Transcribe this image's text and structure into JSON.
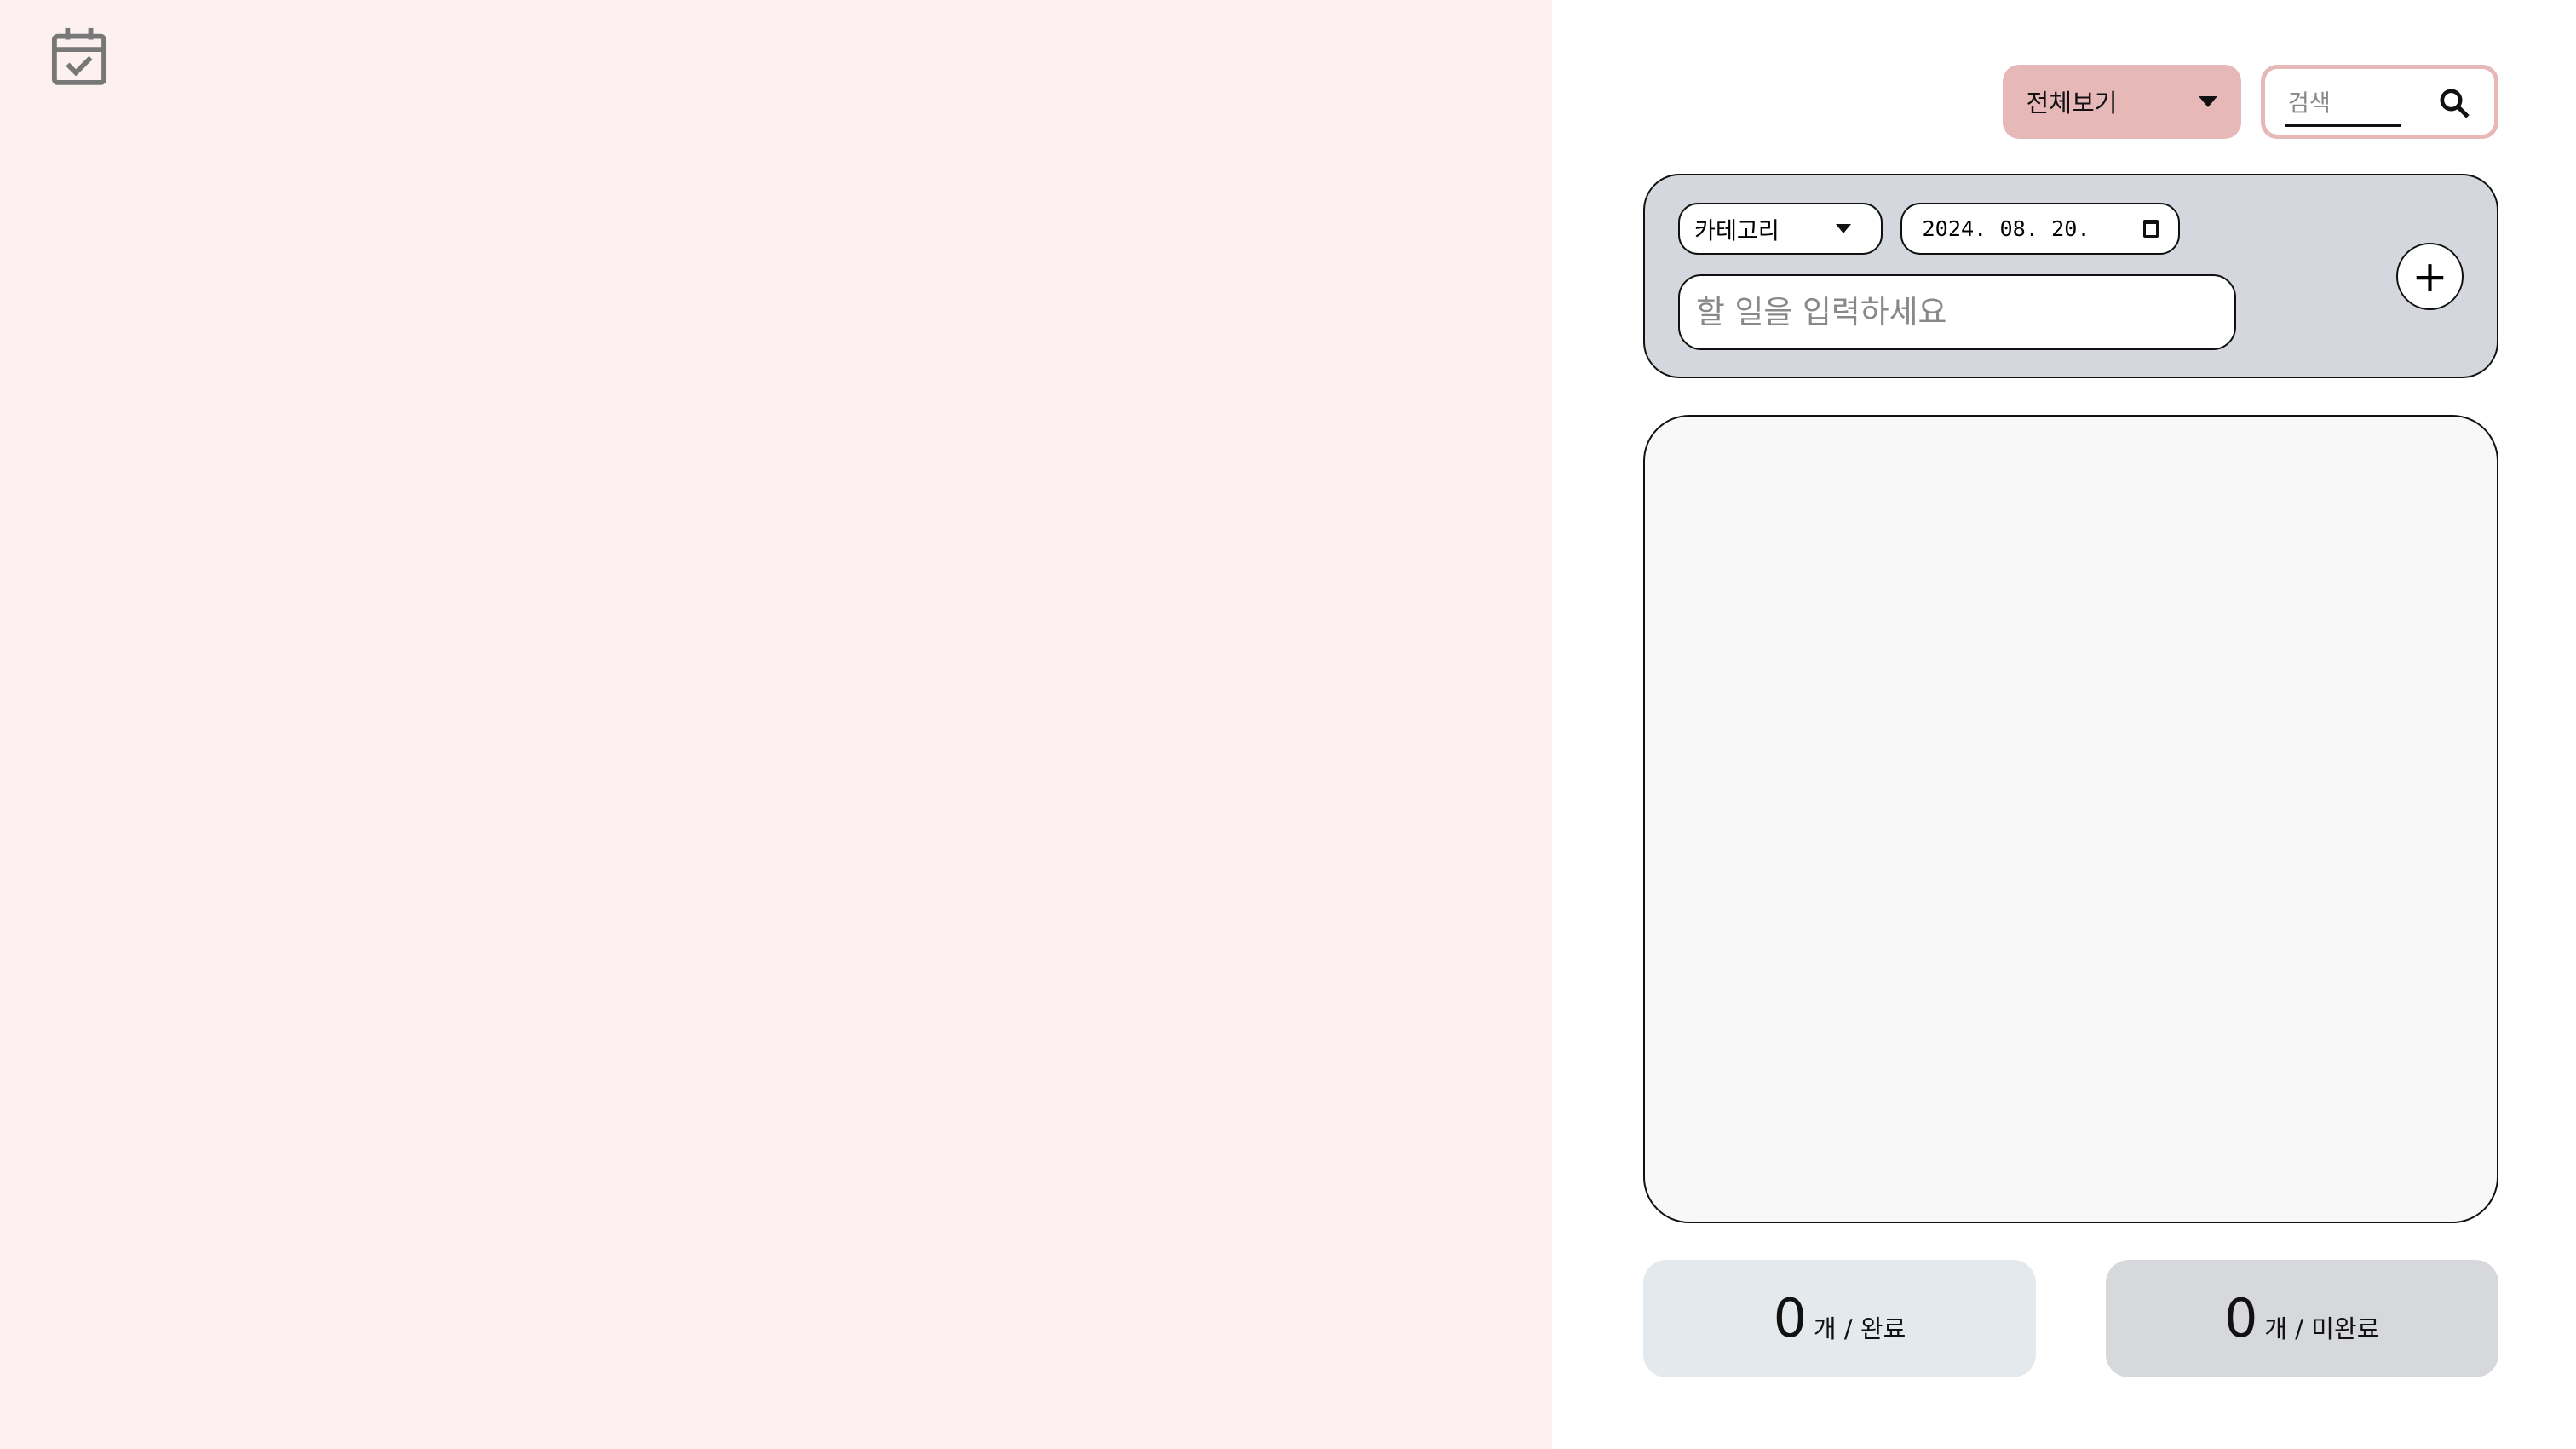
{
  "sidebar": {
    "icon": "calendar-check-icon",
    "background": "#fcf1f0"
  },
  "header": {
    "filter": {
      "selected": "전체보기",
      "icon": "caret-down-icon",
      "color": "#e6b8b8"
    },
    "search": {
      "placeholder": "검색",
      "value": "",
      "icon": "search-icon"
    }
  },
  "form": {
    "category": {
      "selected": "카테고리",
      "icon": "caret-down-icon"
    },
    "date": {
      "value": "2024. 08. 20.",
      "icon": "calendar-icon"
    },
    "task_input": {
      "placeholder": "할 일을 입력하세요",
      "value": ""
    },
    "add_label": "+"
  },
  "todo_list": {
    "items": []
  },
  "stats": {
    "completed": {
      "count": "0",
      "label": "개 / 완료"
    },
    "incomplete": {
      "count": "0",
      "label": "개 / 미완료"
    }
  }
}
